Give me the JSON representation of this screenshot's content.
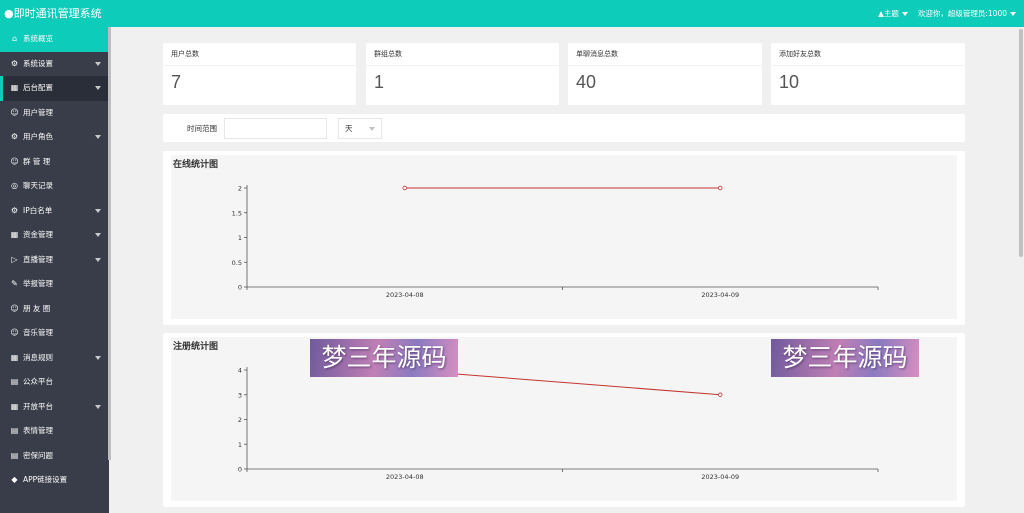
{
  "header": {
    "brand": "●即时通讯管理系统",
    "theme_label": "主题",
    "welcome_text": "欢迎你，超级管理员:1000"
  },
  "sidebar": {
    "items": [
      {
        "label": "系统概览",
        "icon": "home-icon",
        "arrow": false
      },
      {
        "label": "系统设置",
        "icon": "gear-icon",
        "arrow": true
      },
      {
        "label": "后台配置",
        "icon": "calendar-icon",
        "arrow": true
      },
      {
        "label": "用户管理",
        "icon": "user-icon",
        "arrow": false
      },
      {
        "label": "用户角色",
        "icon": "gear-icon",
        "arrow": true
      },
      {
        "label": "群 管 理",
        "icon": "group-icon",
        "arrow": false
      },
      {
        "label": "聊天记录",
        "icon": "chat-icon",
        "arrow": false
      },
      {
        "label": "IP白名单",
        "icon": "gear-icon",
        "arrow": true
      },
      {
        "label": "资金管理",
        "icon": "calendar-icon",
        "arrow": true
      },
      {
        "label": "直播管理",
        "icon": "video-icon",
        "arrow": true
      },
      {
        "label": "举报管理",
        "icon": "report-icon",
        "arrow": false
      },
      {
        "label": "朋 友 圈",
        "icon": "smile-icon",
        "arrow": false
      },
      {
        "label": "音乐管理",
        "icon": "smile-icon",
        "arrow": false
      },
      {
        "label": "消息规则",
        "icon": "calendar-icon",
        "arrow": true
      },
      {
        "label": "公众平台",
        "icon": "card-icon",
        "arrow": false
      },
      {
        "label": "开放平台",
        "icon": "calendar-icon",
        "arrow": true
      },
      {
        "label": "表情管理",
        "icon": "card-icon",
        "arrow": false
      },
      {
        "label": "密保问题",
        "icon": "card-icon",
        "arrow": false
      },
      {
        "label": "APP链接设置",
        "icon": "layers-icon",
        "arrow": false
      }
    ]
  },
  "stats": [
    {
      "label": "用户总数",
      "value": "7"
    },
    {
      "label": "群组总数",
      "value": "1"
    },
    {
      "label": "单聊消息总数",
      "value": "40"
    },
    {
      "label": "添加好友总数",
      "value": "10"
    }
  ],
  "filter": {
    "label": "时间范围",
    "input_value": "",
    "select_value": "天"
  },
  "online_chart_title": "在线统计图",
  "register_chart_title": "注册统计图",
  "watermark_text": "梦三年源码",
  "chart_data": [
    {
      "type": "line",
      "title": "在线统计图",
      "categories": [
        "2023-04-08",
        "2023-04-09"
      ],
      "series": [
        {
          "values": [
            2,
            2
          ],
          "color": "#c23531"
        }
      ],
      "y_ticks": [
        "0",
        "0.5",
        "1",
        "1.5",
        "2"
      ],
      "ylim": [
        0,
        2
      ]
    },
    {
      "type": "line",
      "title": "注册统计图",
      "categories": [
        "2023-04-08",
        "2023-04-09"
      ],
      "series": [
        {
          "values": [
            4,
            3
          ],
          "color": "#c23531"
        }
      ],
      "y_ticks": [
        "0",
        "1",
        "2",
        "3",
        "4"
      ],
      "ylim": [
        0,
        4
      ]
    }
  ]
}
